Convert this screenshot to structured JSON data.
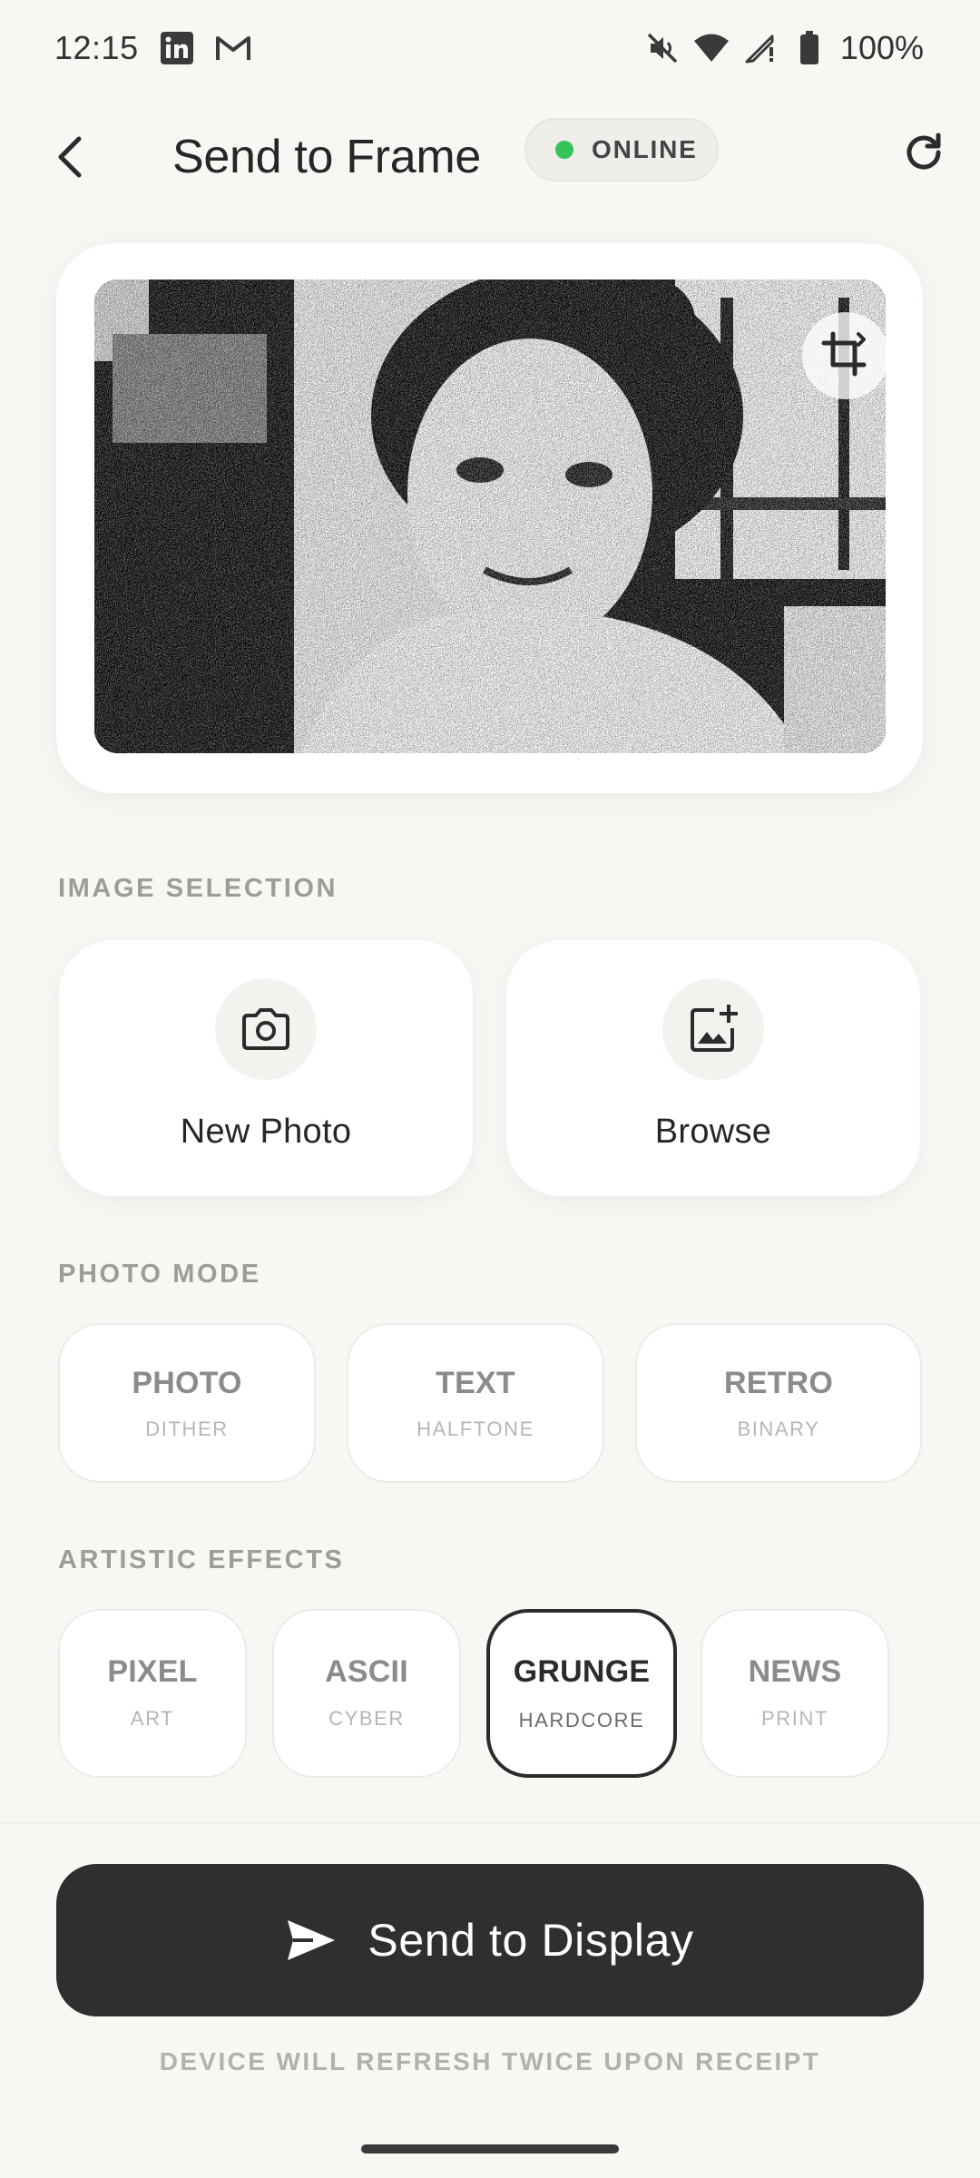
{
  "status_bar": {
    "time": "12:15",
    "battery_text": "100%",
    "notification_icons": [
      "linkedin-icon",
      "gmail-icon"
    ],
    "system_icons": [
      "mute-icon",
      "wifi-icon",
      "signal-icon",
      "battery-icon"
    ]
  },
  "appbar": {
    "title": "Send to Frame",
    "status_label": "ONLINE",
    "status_color": "#35c45a",
    "back_icon": "chevron-left-icon",
    "refresh_icon": "refresh-icon"
  },
  "preview": {
    "crop_icon": "crop-icon",
    "alt": "Dithered black-and-white photo of a woman"
  },
  "image_selection": {
    "header": "IMAGE SELECTION",
    "buttons": [
      {
        "label": "New Photo",
        "icon": "camera-icon"
      },
      {
        "label": "Browse",
        "icon": "add-image-icon"
      }
    ]
  },
  "photo_mode": {
    "header": "PHOTO MODE",
    "options": [
      {
        "title": "PHOTO",
        "subtitle": "DITHER"
      },
      {
        "title": "TEXT",
        "subtitle": "HALFTONE"
      },
      {
        "title": "RETRO",
        "subtitle": "BINARY"
      }
    ]
  },
  "artistic_effects": {
    "header": "ARTISTIC EFFECTS",
    "selected": "GRUNGE",
    "options": [
      {
        "title": "PIXEL",
        "subtitle": "ART"
      },
      {
        "title": "ASCII",
        "subtitle": "CYBER"
      },
      {
        "title": "GRUNGE",
        "subtitle": "HARDCORE"
      },
      {
        "title": "NEWS",
        "subtitle": "PRINT"
      }
    ]
  },
  "send": {
    "label": "Send to Display",
    "icon": "send-icon",
    "footnote": "DEVICE WILL REFRESH TWICE UPON RECEIPT"
  },
  "theme": {
    "background": "#f8f7f4",
    "primary_button": "#2f2f2f",
    "accent_online": "#35c45a"
  }
}
